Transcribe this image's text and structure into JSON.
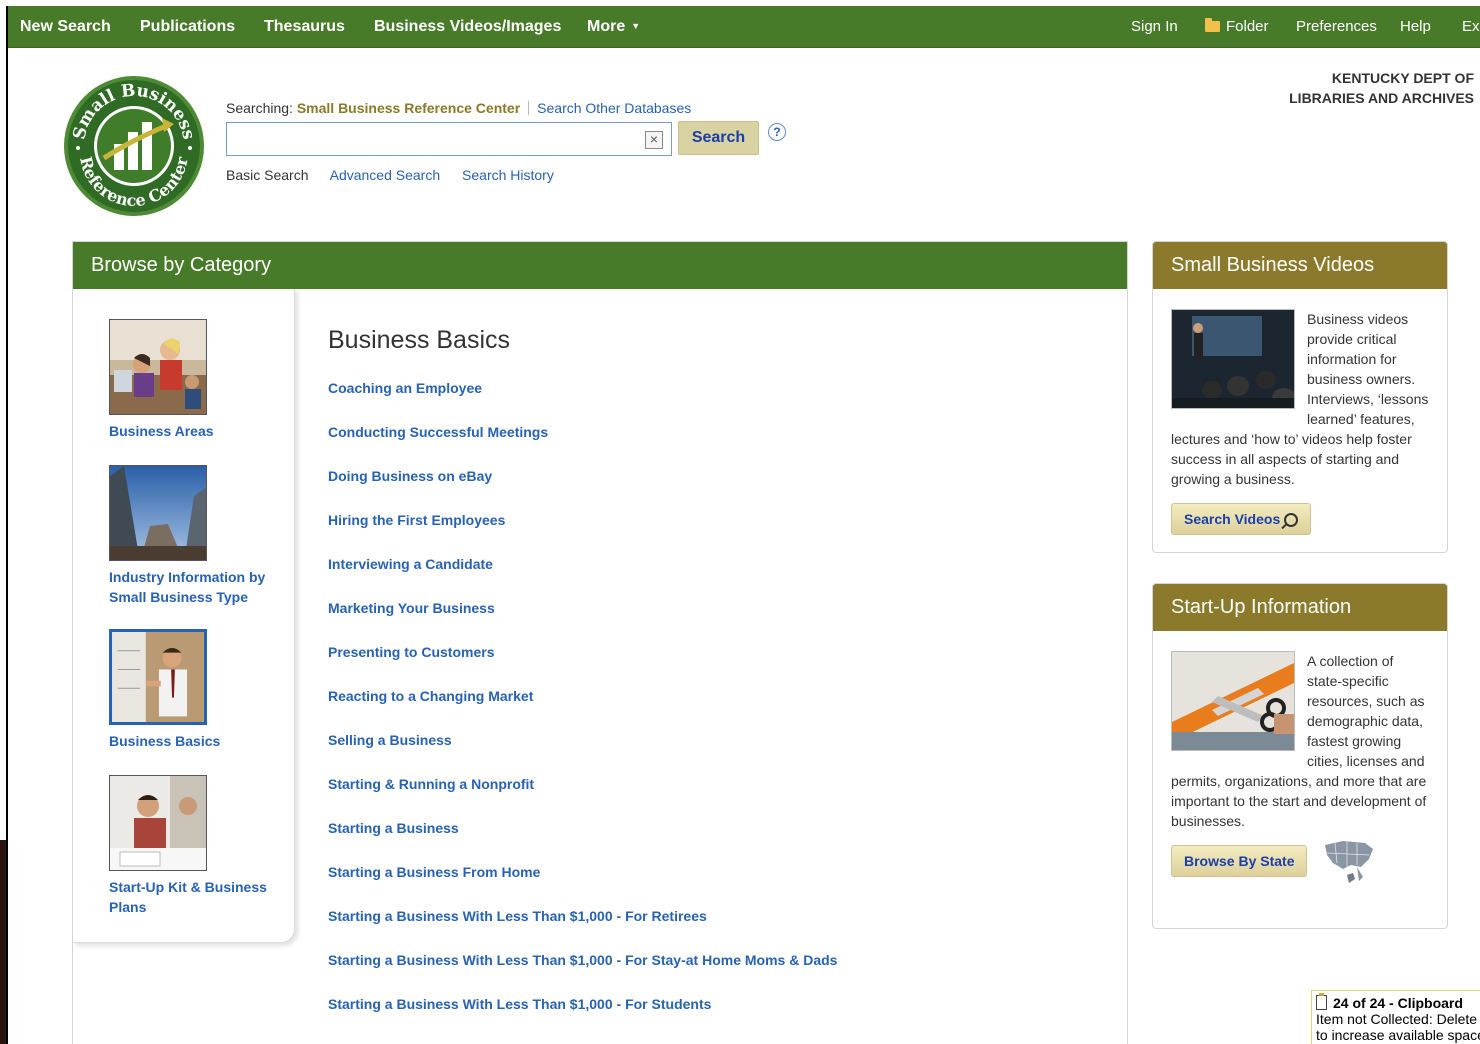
{
  "topnav": {
    "left_items": [
      "New Search",
      "Publications",
      "Thesaurus",
      "Business Videos/Images",
      "More"
    ],
    "right_items": [
      "Sign In",
      "Folder",
      "Preferences",
      "Help",
      "Ex"
    ]
  },
  "logo": {
    "top_text": "Small Business",
    "bottom_text": "Reference Center"
  },
  "search": {
    "searching_label": "Searching:",
    "database": "Small Business Reference Center",
    "other_databases": "Search Other Databases",
    "input_value": "",
    "button_label": "Search",
    "help": "?",
    "tabs": [
      "Basic Search",
      "Advanced Search",
      "Search History"
    ]
  },
  "institution": "KENTUCKY DEPT OF\nLIBRARIES AND ARCHIVES",
  "browse": {
    "title": "Browse by Category",
    "categories": [
      {
        "label": "Business Areas",
        "selected": false
      },
      {
        "label": "Industry Information by Small Business Type",
        "selected": false
      },
      {
        "label": "Business Basics",
        "selected": true
      },
      {
        "label": "Start-Up Kit & Business Plans",
        "selected": false
      }
    ],
    "section_title": "Business Basics",
    "topics": [
      "Coaching an Employee",
      "Conducting Successful Meetings",
      "Doing Business on eBay",
      "Hiring the First Employees",
      "Interviewing a Candidate",
      "Marketing Your Business",
      "Presenting to Customers",
      "Reacting to a Changing Market",
      "Selling a Business",
      "Starting & Running a Nonprofit",
      "Starting a Business",
      "Starting a Business From Home",
      "Starting a Business With Less Than $1,000 - For Retirees",
      "Starting a Business With Less Than $1,000 - For Stay-at Home Moms & Dads",
      "Starting a Business With Less Than $1,000 - For Students"
    ]
  },
  "videos_panel": {
    "title": "Small Business Videos",
    "text": "Business videos provide critical information for business owners. Interviews, ‘lessons learned’ features, lectures and ‘how to’ videos help foster success in all aspects of starting and growing a business.",
    "button": "Search Videos"
  },
  "startup_panel": {
    "title": "Start-Up Information",
    "text": "A collection of state-specific resources, such as demographic data, fastest growing cities, licenses and permits, organizations, and more that are important to the start and development of businesses.",
    "button": "Browse By State"
  },
  "clipboard": {
    "title": "24 of 24 - Clipboard",
    "line1": "Item not Collected: Delete",
    "line2": "to increase available space"
  },
  "colors": {
    "nav_green": "#477b2a",
    "panel_olive": "#8b7a2c",
    "link_blue": "#2862b3"
  }
}
